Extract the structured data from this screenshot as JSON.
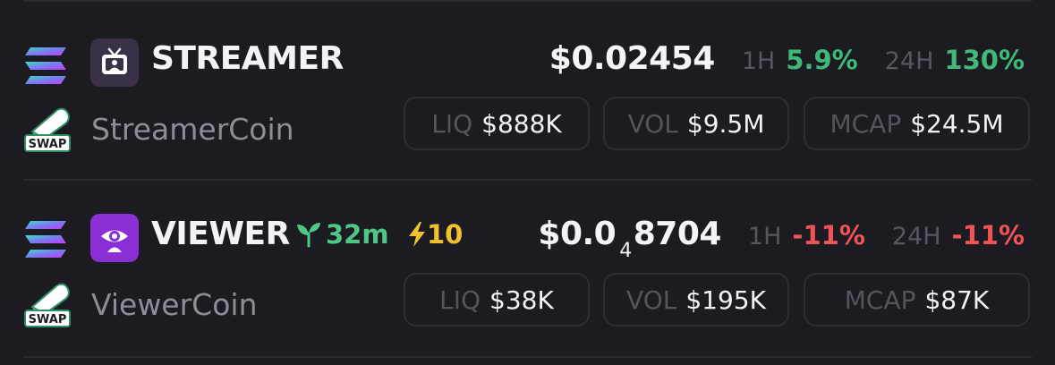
{
  "rows": [
    {
      "symbol": "STREAMER",
      "name": "StreamerCoin",
      "price_main": "$0.02454",
      "tf_1h": "1H",
      "chg_1h": "5.9%",
      "tf_24h": "24H",
      "chg_24h": "130%",
      "liq_label": "LIQ",
      "liq": "$888K",
      "vol_label": "VOL",
      "vol": "$9.5M",
      "mcap_label": "MCAP",
      "mcap": "$24.5M",
      "icon": "tv-icon",
      "icon_color": "#3a3148"
    },
    {
      "symbol": "VIEWER",
      "name": "ViewerCoin",
      "age": "32m",
      "boost": "10",
      "price_prefix": "$0.0",
      "price_sub": "4",
      "price_rest": "8704",
      "tf_1h": "1H",
      "chg_1h": "-11%",
      "tf_24h": "24H",
      "chg_24h": "-11%",
      "liq_label": "LIQ",
      "liq": "$38K",
      "vol_label": "VOL",
      "vol": "$195K",
      "mcap_label": "MCAP",
      "mcap": "$87K",
      "icon": "eye-icon",
      "icon_color": "#8a2fd6"
    }
  ],
  "swap_label": "SWAP",
  "colors": {
    "up": "#3fb878",
    "down": "#ef5457",
    "age": "#4ec784",
    "boost": "#f2c12e"
  }
}
